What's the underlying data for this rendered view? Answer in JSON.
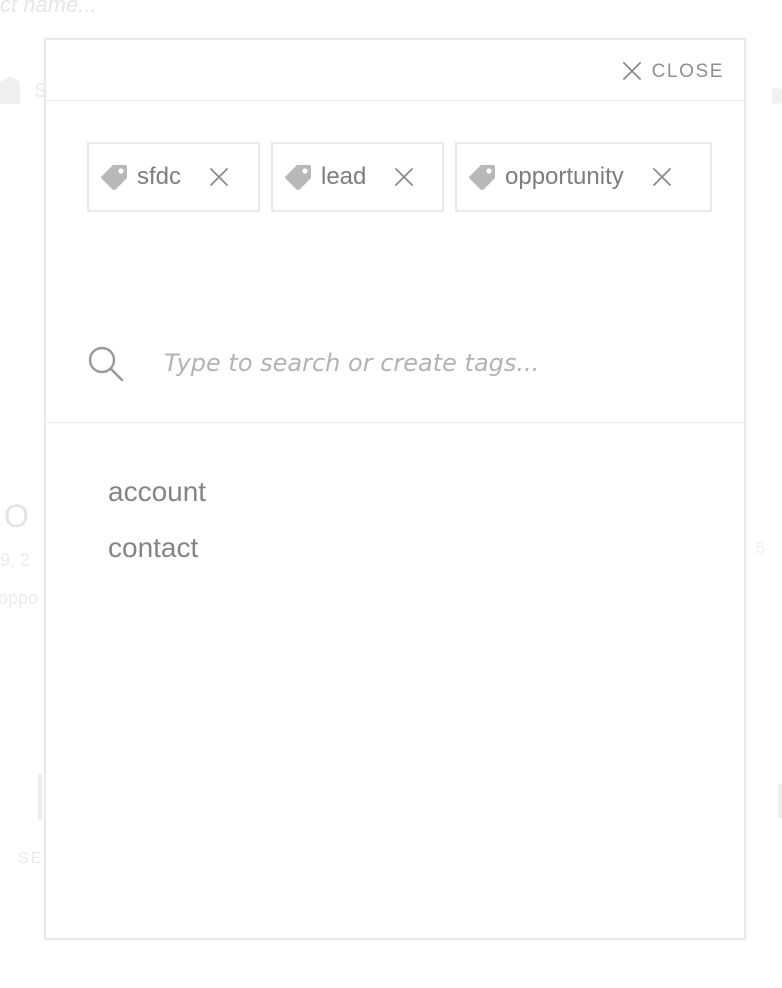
{
  "background": {
    "top_text": "ct name...",
    "small_text": "S",
    "big_text": "O",
    "date_text": "9, 2",
    "sub_text": "oppo",
    "bottom_text": "SE",
    "right_text": "5"
  },
  "modal": {
    "close_label": "CLOSE",
    "chips": [
      {
        "label": "sfdc",
        "icon": "tag-icon"
      },
      {
        "label": "lead",
        "icon": "tag-icon"
      },
      {
        "label": "opportunity",
        "icon": "tag-icon"
      }
    ],
    "search": {
      "placeholder": "Type to search or create tags...",
      "value": ""
    },
    "suggestions": [
      "account",
      "contact"
    ]
  },
  "colors": {
    "text": "#7d7d7d",
    "icon": "#b8b8b8",
    "border": "#e9e9e9",
    "placeholder": "#b3b3b3"
  }
}
